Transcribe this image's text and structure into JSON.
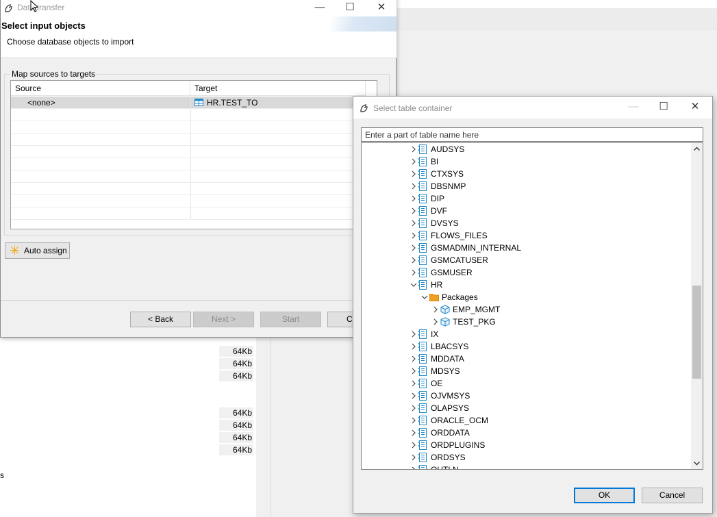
{
  "background": {
    "sizes": [
      "64Kb",
      "64Kb",
      "64Kb",
      "64Kb",
      "64Kb",
      "64Kb",
      "64Kb"
    ],
    "truncated_text": "s"
  },
  "wizard": {
    "title": "Data transfer",
    "heading": "Select input objects",
    "subheading": "Choose database objects to import",
    "group_label": "Map sources to targets",
    "columns": {
      "source": "Source",
      "target": "Target"
    },
    "rows": [
      {
        "source": "<none>",
        "target": "HR.TEST_TO",
        "target_icon": "table-icon"
      }
    ],
    "auto_assign_label": "Auto assign",
    "buttons": {
      "back": "< Back",
      "next": "Next >",
      "start": "Start",
      "cancel": "Cancel"
    },
    "window_buttons": {
      "minimize": "—",
      "maximize": "☐",
      "close": "✕"
    }
  },
  "dialog": {
    "title": "Select table container",
    "filter_placeholder": "Enter a part of table name here",
    "tree": [
      {
        "label": "AUDSYS",
        "level": 0,
        "expanded": false,
        "icon": "schema-icon"
      },
      {
        "label": "BI",
        "level": 0,
        "expanded": false,
        "icon": "schema-icon"
      },
      {
        "label": "CTXSYS",
        "level": 0,
        "expanded": false,
        "icon": "schema-icon"
      },
      {
        "label": "DBSNMP",
        "level": 0,
        "expanded": false,
        "icon": "schema-icon"
      },
      {
        "label": "DIP",
        "level": 0,
        "expanded": false,
        "icon": "schema-icon"
      },
      {
        "label": "DVF",
        "level": 0,
        "expanded": false,
        "icon": "schema-icon"
      },
      {
        "label": "DVSYS",
        "level": 0,
        "expanded": false,
        "icon": "schema-icon"
      },
      {
        "label": "FLOWS_FILES",
        "level": 0,
        "expanded": false,
        "icon": "schema-icon"
      },
      {
        "label": "GSMADMIN_INTERNAL",
        "level": 0,
        "expanded": false,
        "icon": "schema-icon"
      },
      {
        "label": "GSMCATUSER",
        "level": 0,
        "expanded": false,
        "icon": "schema-icon"
      },
      {
        "label": "GSMUSER",
        "level": 0,
        "expanded": false,
        "icon": "schema-icon"
      },
      {
        "label": "HR",
        "level": 0,
        "expanded": true,
        "icon": "schema-icon"
      },
      {
        "label": "Packages",
        "level": 1,
        "expanded": true,
        "icon": "folder-icon"
      },
      {
        "label": "EMP_MGMT",
        "level": 2,
        "expanded": false,
        "icon": "package-icon"
      },
      {
        "label": "TEST_PKG",
        "level": 2,
        "expanded": false,
        "icon": "package-icon"
      },
      {
        "label": "IX",
        "level": 0,
        "expanded": false,
        "icon": "schema-icon"
      },
      {
        "label": "LBACSYS",
        "level": 0,
        "expanded": false,
        "icon": "schema-icon"
      },
      {
        "label": "MDDATA",
        "level": 0,
        "expanded": false,
        "icon": "schema-icon"
      },
      {
        "label": "MDSYS",
        "level": 0,
        "expanded": false,
        "icon": "schema-icon"
      },
      {
        "label": "OE",
        "level": 0,
        "expanded": false,
        "icon": "schema-icon"
      },
      {
        "label": "OJVMSYS",
        "level": 0,
        "expanded": false,
        "icon": "schema-icon"
      },
      {
        "label": "OLAPSYS",
        "level": 0,
        "expanded": false,
        "icon": "schema-icon"
      },
      {
        "label": "ORACLE_OCM",
        "level": 0,
        "expanded": false,
        "icon": "schema-icon"
      },
      {
        "label": "ORDDATA",
        "level": 0,
        "expanded": false,
        "icon": "schema-icon"
      },
      {
        "label": "ORDPLUGINS",
        "level": 0,
        "expanded": false,
        "icon": "schema-icon"
      },
      {
        "label": "ORDSYS",
        "level": 0,
        "expanded": false,
        "icon": "schema-icon"
      },
      {
        "label": "OUTLN",
        "level": 0,
        "expanded": false,
        "icon": "schema-icon"
      }
    ],
    "buttons": {
      "ok": "OK",
      "cancel": "Cancel"
    },
    "window_buttons": {
      "minimize": "—",
      "maximize": "☐",
      "close": "✕"
    }
  },
  "colors": {
    "accent": "#0078d7",
    "icon_blue": "#1e88c8",
    "folder": "#f0a020",
    "selection": "#d9d9d9"
  }
}
